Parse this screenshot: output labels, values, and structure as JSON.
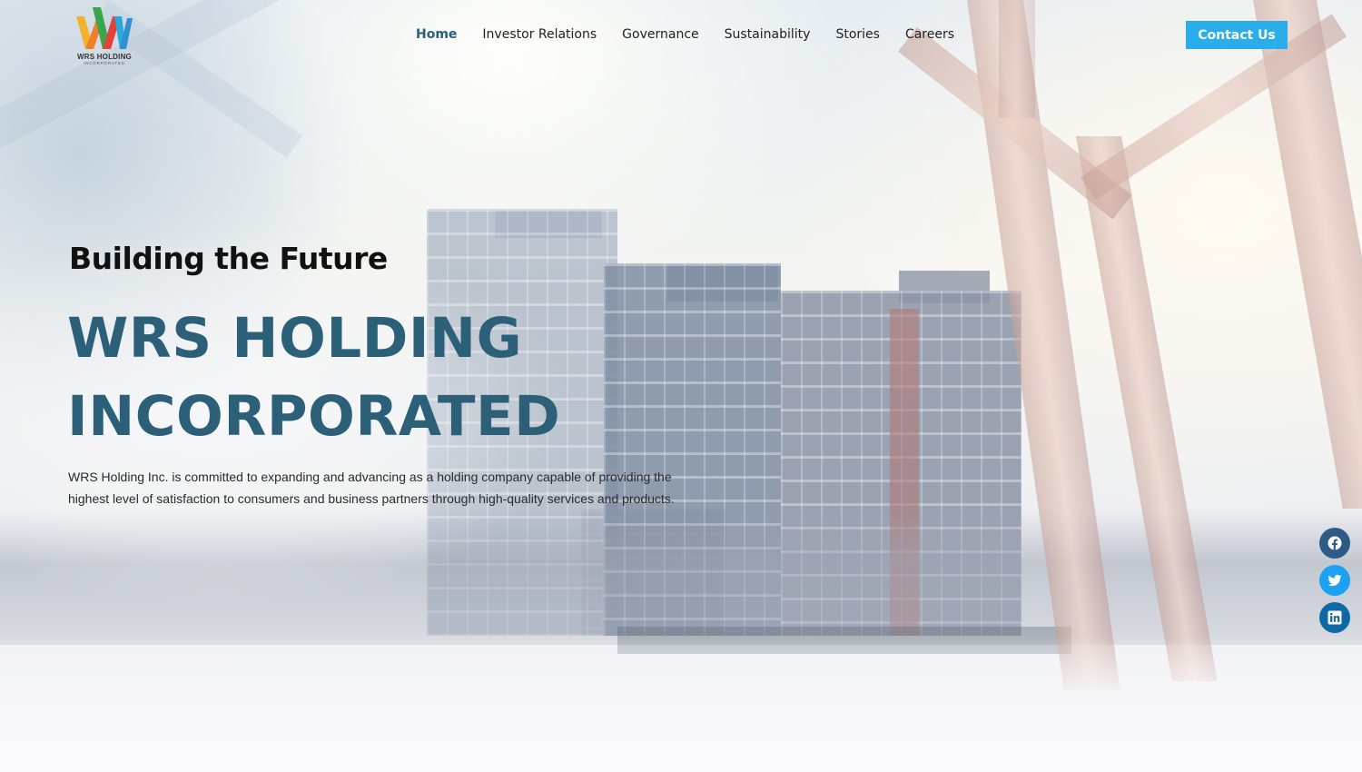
{
  "brand": {
    "logo_line1": "WRS HOLDING",
    "logo_line2": "INCORPORATED",
    "colors": {
      "yellow": "#f2b22b",
      "green": "#3aa54a",
      "red": "#e2443b",
      "orange": "#f07f2a",
      "blue": "#2aa7dd"
    }
  },
  "nav": {
    "items": [
      {
        "label": "Home",
        "active": true
      },
      {
        "label": "Investor Relations"
      },
      {
        "label": "Governance"
      },
      {
        "label": "Sustainability"
      },
      {
        "label": "Stories"
      },
      {
        "label": "Careers"
      }
    ],
    "active_color": "#2a5f7c"
  },
  "header": {
    "contact_label": "Contact Us",
    "contact_color": "#29aee9"
  },
  "hero": {
    "tagline": "Building the Future",
    "headline_line1": "WRS HOLDING",
    "headline_line2": "INCORPORATED",
    "headline_color": "#2c6079",
    "description": "WRS Holding Inc. is committed to expanding and advancing as a holding company capable of providing the highest level of satisfaction to consumers and business partners through high-quality services and products."
  },
  "social": [
    {
      "icon": "facebook-icon",
      "color": "#2d5b86"
    },
    {
      "icon": "twitter-icon",
      "color": "#1da1f2"
    },
    {
      "icon": "linkedin-icon",
      "color": "#0c69a4"
    }
  ]
}
